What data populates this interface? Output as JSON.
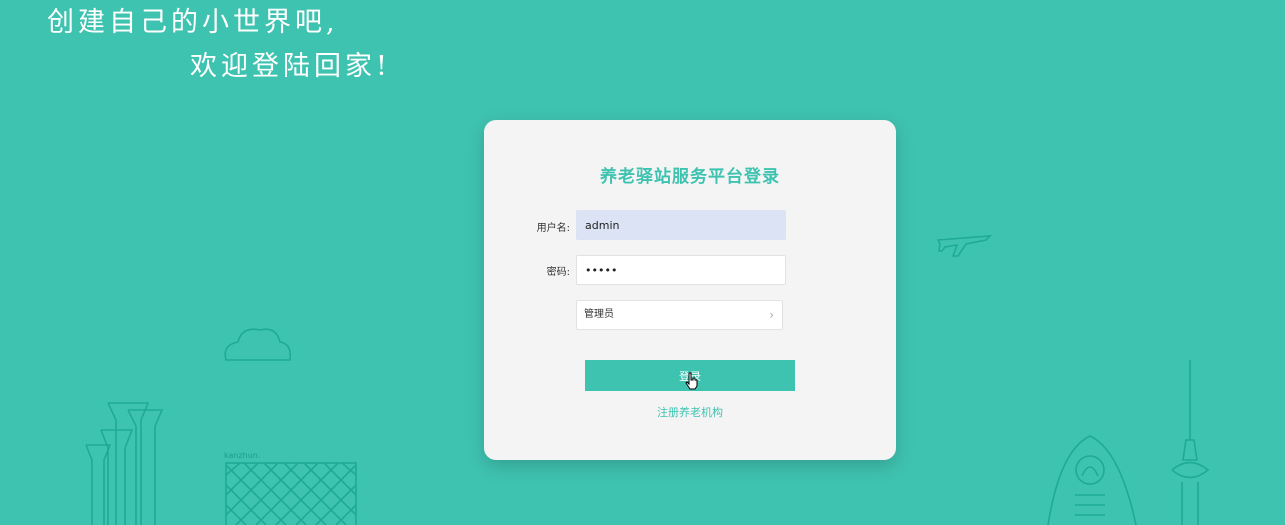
{
  "slogan": {
    "line1": "创建自己的小世界吧,",
    "line2": "欢迎登陆回家!"
  },
  "login": {
    "title": "养老驿站服务平台登录",
    "username_label": "用户名:",
    "username_value": "admin",
    "password_label": "密码:",
    "password_value": "•••••",
    "role_value": "管理员",
    "submit_label": "登录",
    "register_label": "注册养老机构"
  },
  "decor": {
    "building_text": "kanzhun."
  },
  "colors": {
    "accent": "#3fc3b1",
    "card": "#f4f4f4",
    "autofill": "#dbe3f4"
  }
}
